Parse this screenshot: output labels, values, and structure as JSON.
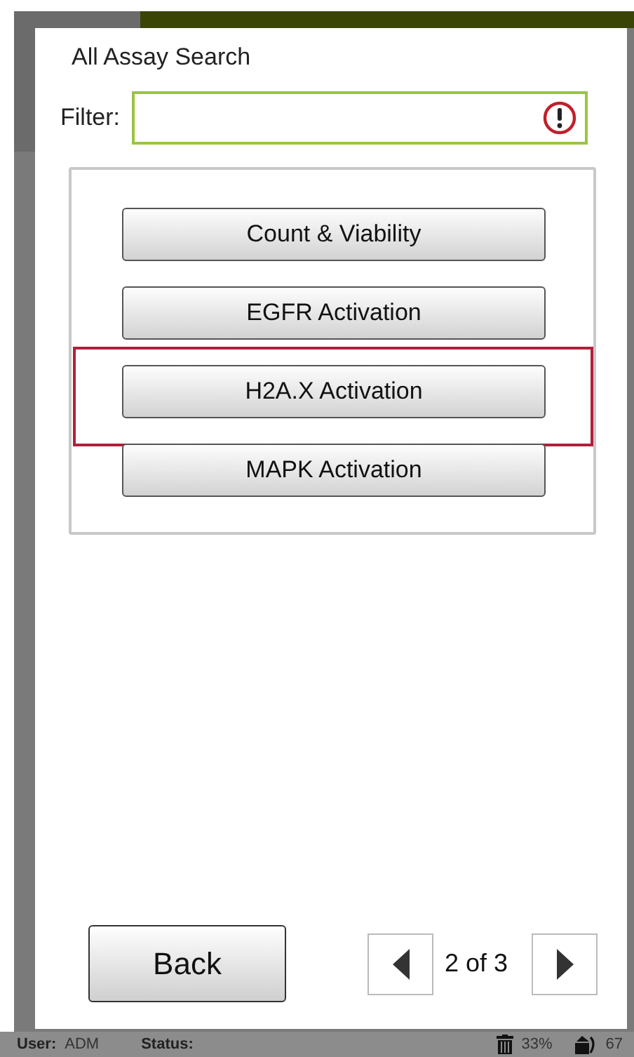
{
  "dialog": {
    "title": "All Assay Search",
    "filter": {
      "label": "Filter:",
      "error": true
    },
    "assays": [
      {
        "label": "Count & Viability",
        "highlighted": false
      },
      {
        "label": "EGFR Activation",
        "highlighted": false
      },
      {
        "label": "H2A.X Activation",
        "highlighted": true
      },
      {
        "label": "MAPK Activation",
        "highlighted": false
      }
    ],
    "back_button": "Back",
    "pager": {
      "text": "2 of 3"
    }
  },
  "status_bar": {
    "user_label": "User:",
    "user": "ADM",
    "status_label": "Status:",
    "trash_reading": "33%",
    "tray_reading": "67"
  }
}
